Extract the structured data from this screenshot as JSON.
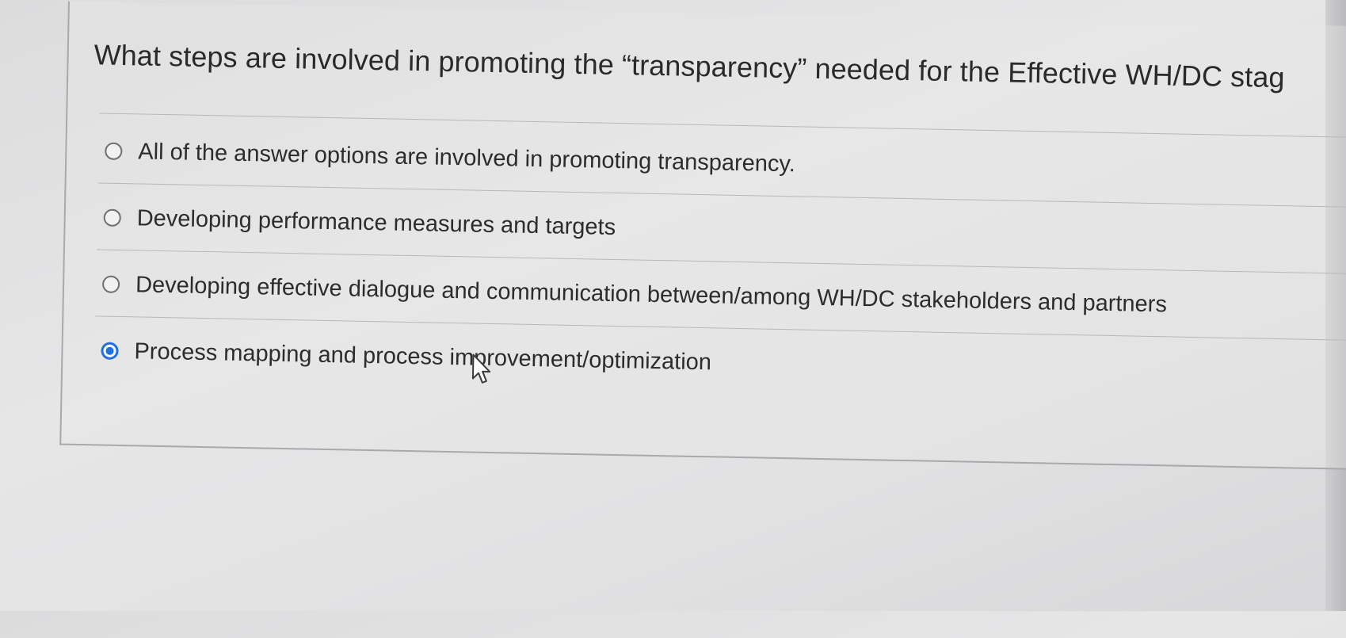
{
  "question": {
    "text": "What steps are involved in promoting the “transparency” needed for the Effective WH/DC stag"
  },
  "options": [
    {
      "label": "All of the answer options are involved in promoting transparency.",
      "selected": false
    },
    {
      "label": "Developing performance measures and targets",
      "selected": false
    },
    {
      "label": "Developing effective dialogue and communication between/among WH/DC stakeholders and partners",
      "selected": false
    },
    {
      "label": "Process mapping and process improvement/optimization",
      "selected": true
    }
  ],
  "colors": {
    "selected_radio": "#1f6fe0",
    "text": "#2c2c2e"
  }
}
